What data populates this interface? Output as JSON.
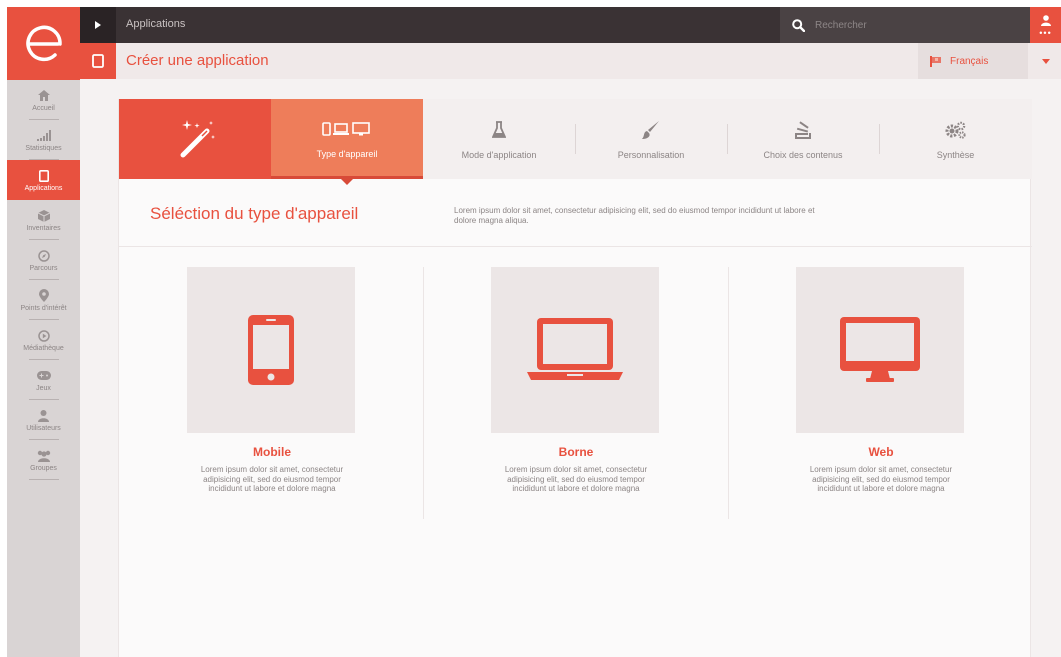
{
  "topbar": {
    "breadcrumb": "Applications",
    "search_placeholder": "Rechercher",
    "user_dots": "•••"
  },
  "subheader": {
    "title": "Créer une application",
    "language": "Français"
  },
  "sidebar": {
    "items": [
      {
        "label": "Accueil",
        "icon": "home-icon"
      },
      {
        "label": "Statistiques",
        "icon": "stats-icon"
      },
      {
        "label": "Applications",
        "icon": "tablet-icon",
        "active": true
      },
      {
        "label": "Inventaires",
        "icon": "box-icon"
      },
      {
        "label": "Parcours",
        "icon": "compass-icon"
      },
      {
        "label": "Points d'intérêt",
        "icon": "pin-icon"
      },
      {
        "label": "Médiathèque",
        "icon": "play-icon"
      },
      {
        "label": "Jeux",
        "icon": "gamepad-icon"
      },
      {
        "label": "Utilisateurs",
        "icon": "user-icon"
      },
      {
        "label": "Groupes",
        "icon": "group-icon"
      }
    ]
  },
  "steps": [
    {
      "label": "Type d'appareil",
      "icon": "devices-icon",
      "active": true
    },
    {
      "label": "Mode d'application",
      "icon": "flask-icon"
    },
    {
      "label": "Personnalisation",
      "icon": "brush-icon"
    },
    {
      "label": "Choix des contenus",
      "icon": "stack-icon"
    },
    {
      "label": "Synthèse",
      "icon": "gears-icon"
    }
  ],
  "section": {
    "title": "Séléction du type d'appareil",
    "description": "Lorem ipsum dolor sit amet, consectetur adipisicing elit, sed do eiusmod tempor incididunt ut labore et dolore magna aliqua."
  },
  "devices": [
    {
      "name": "Mobile",
      "icon": "mobile-icon",
      "description": "Lorem ipsum dolor sit amet, consectetur adipisicing elit, sed do eiusmod tempor incididunt ut labore et dolore magna"
    },
    {
      "name": "Borne",
      "icon": "laptop-icon",
      "description": "Lorem ipsum dolor sit amet, consectetur adipisicing elit, sed do eiusmod tempor incididunt ut labore et dolore magna"
    },
    {
      "name": "Web",
      "icon": "monitor-icon",
      "description": "Lorem ipsum dolor sit amet, consectetur adipisicing elit, sed do eiusmod tempor incididunt ut labore et dolore magna"
    }
  ],
  "colors": {
    "accent": "#e8513f",
    "accent_light": "#ee7d5a",
    "topbar": "#3a3234",
    "sidebar": "#d9d4d4"
  }
}
